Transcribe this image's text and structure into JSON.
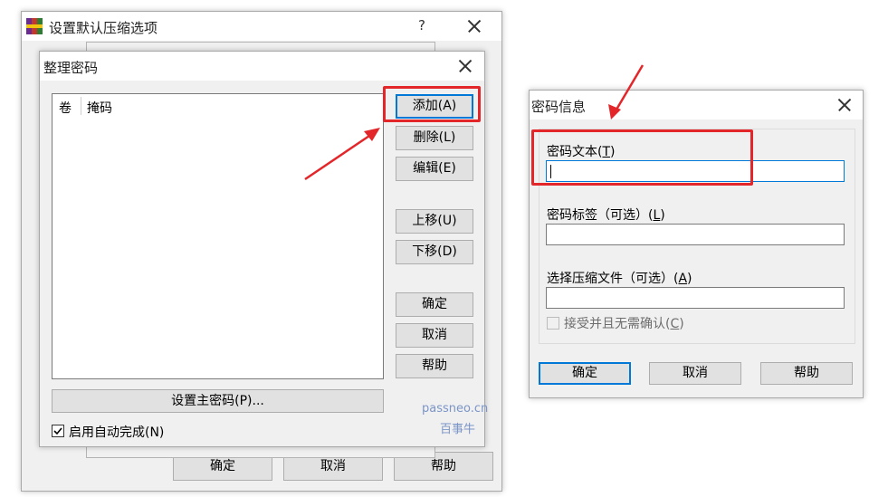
{
  "background_window": {
    "title": "设置默认压缩选项",
    "help_glyph": "?",
    "buttons": {
      "ok": "确定",
      "cancel": "取消",
      "help": "帮助"
    }
  },
  "organize_dialog": {
    "title": "整理密码",
    "columns": [
      "卷",
      "掩码"
    ],
    "buttons": {
      "add": "添加(A)",
      "delete": "删除(L)",
      "edit": "编辑(E)",
      "up": "上移(U)",
      "down": "下移(D)",
      "ok": "确定",
      "cancel": "取消",
      "help": "帮助",
      "set_master": "设置主密码(P)..."
    },
    "autocomplete": {
      "label": "启用自动完成(N)",
      "checked": true
    }
  },
  "password_info_dialog": {
    "title": "密码信息",
    "password_text_label": "密码文本(",
    "password_text_key": "T",
    "password_label_label": "密码标签（可选）(",
    "password_label_key": "L",
    "archive_label": "选择压缩文件（可选）(",
    "archive_key": "A",
    "accept_label": "接受并且无需确认(",
    "accept_key": "C",
    "buttons": {
      "ok": "确定",
      "cancel": "取消",
      "help": "帮助"
    }
  },
  "watermark": {
    "line1": "passneo.cn",
    "line2": "百事牛"
  },
  "colors": {
    "highlight": "#e3262a",
    "focus": "#0078d7",
    "watermark": "#7b95c8"
  }
}
